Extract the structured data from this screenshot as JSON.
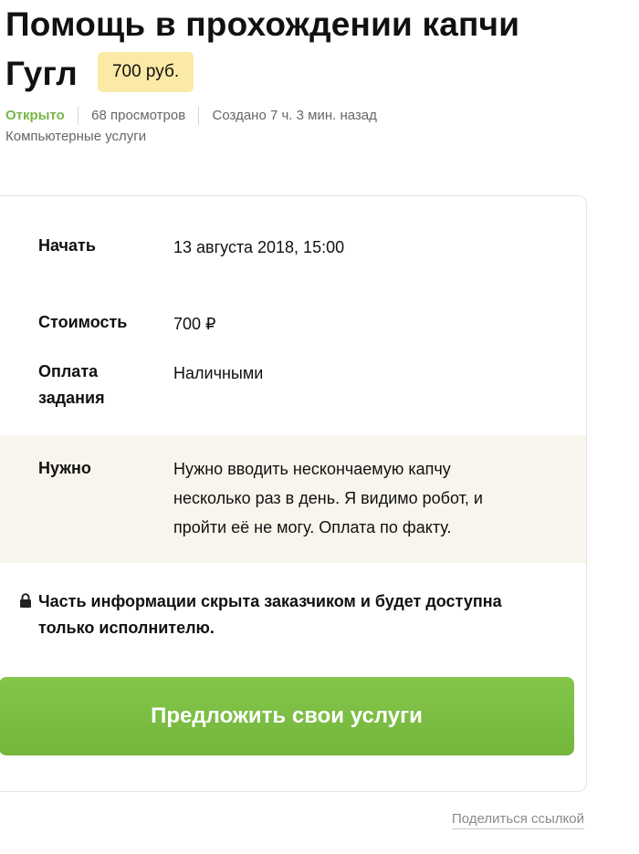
{
  "task": {
    "title_line1": "Помощь в прохождении капчи",
    "title_line2": "Гугл",
    "price_badge": "700 руб.",
    "status": "Открыто",
    "views": "68 просмотров",
    "created": "Создано 7 ч. 3 мин. назад",
    "category": "Компьютерные услуги"
  },
  "details": {
    "start_label": "Начать",
    "start_value": "13 августа 2018, 15:00",
    "cost_label": "Стоимость",
    "cost_value": "700 ₽",
    "payment_label_line1": "Оплата",
    "payment_label_line2": "задания",
    "payment_value": "Наличными",
    "need_label": "Нужно",
    "need_lines": [
      "Нужно вводить нескончаемую капчу",
      "несколько раз в день. Я видимо робот, и",
      "пройти её не могу. Оплата по факту."
    ]
  },
  "notice": {
    "line1": "Часть информации скрыта заказчиком и будет доступна",
    "line2": "только исполнителю."
  },
  "actions": {
    "offer_button": "Предложить свои услуги",
    "share_link": "Поделиться ссылкой"
  },
  "colors": {
    "status_green": "#7ab648",
    "button_green": "#7cbf44",
    "price_badge_bg": "#fbeaa6",
    "need_row_bg": "#f8f5ec"
  },
  "icons": {
    "notice_icon": "lock-icon"
  }
}
